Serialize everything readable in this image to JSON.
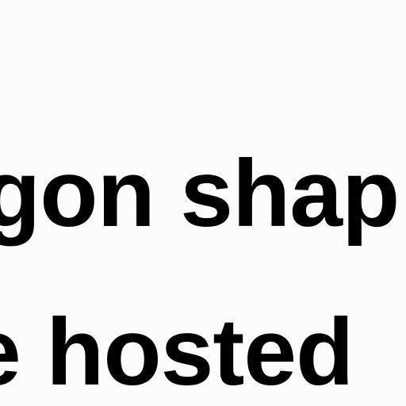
{
  "text_lines": [
    "gon shap",
    "e hosted"
  ],
  "colors": {
    "background": "#fcfcfc",
    "text": "#000000"
  }
}
